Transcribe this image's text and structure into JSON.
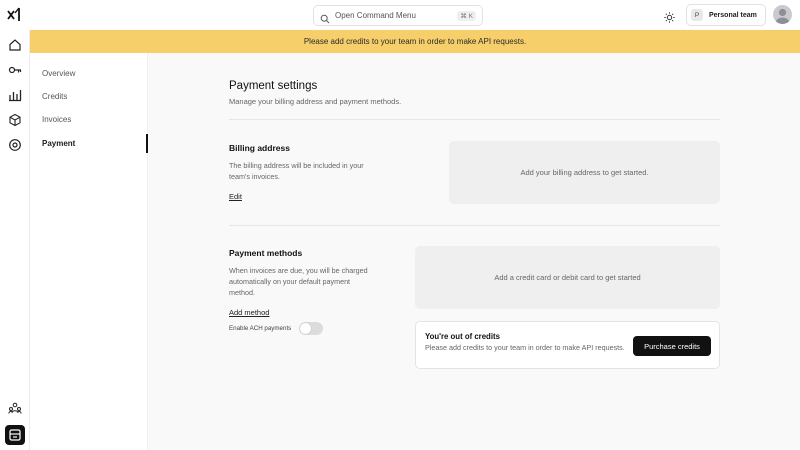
{
  "command_menu": {
    "label": "Open Command Menu",
    "shortcut": "⌘ K"
  },
  "team": {
    "initial": "P",
    "name": "Personal team"
  },
  "banner": {
    "text": "Please add credits to your team in order to make API requests.",
    "color": "#f6cf6a"
  },
  "rail": {
    "icons": [
      "home-icon",
      "key-icon",
      "bar-chart-icon",
      "cube-icon",
      "target-icon",
      "people-icon",
      "panel-icon"
    ]
  },
  "subnav": {
    "items": [
      {
        "label": "Overview",
        "active": false
      },
      {
        "label": "Credits",
        "active": false
      },
      {
        "label": "Invoices",
        "active": false
      },
      {
        "label": "Payment",
        "active": true
      }
    ]
  },
  "page": {
    "title": "Payment settings",
    "subtitle": "Manage your billing address and payment methods."
  },
  "billing": {
    "title": "Billing address",
    "description": "The billing address will be included in your team's invoices.",
    "edit_label": "Edit",
    "placeholder": "Add your billing address to get started."
  },
  "payment_methods": {
    "title": "Payment methods",
    "description": "When invoices are due, you will be charged automatically on your default payment method.",
    "add_label": "Add method",
    "ach_label": "Enable ACH payments",
    "ach_enabled": false,
    "placeholder": "Add a credit card or debit card to get started"
  },
  "credits_alert": {
    "title": "You're out of credits",
    "description": "Please add credits to your team in order to make API requests.",
    "button_label": "Purchase credits"
  }
}
